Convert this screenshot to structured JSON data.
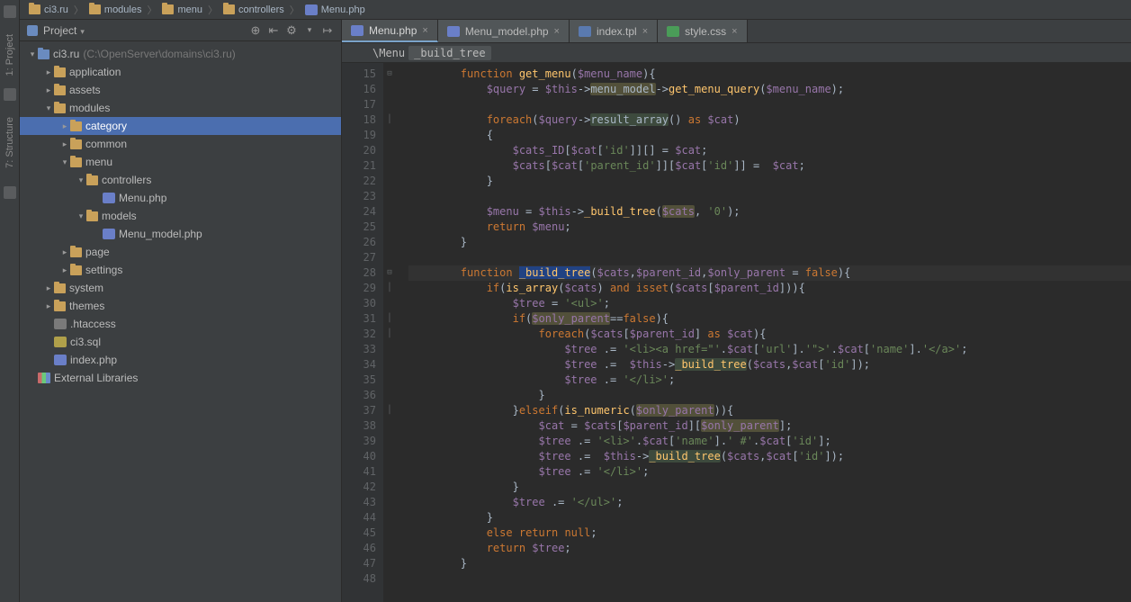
{
  "breadcrumb": [
    {
      "icon": "folder",
      "label": "ci3.ru"
    },
    {
      "icon": "folder",
      "label": "modules"
    },
    {
      "icon": "folder",
      "label": "menu"
    },
    {
      "icon": "folder",
      "label": "controllers"
    },
    {
      "icon": "php",
      "label": "Menu.php"
    }
  ],
  "sidebar_tools": {
    "project": "1: Project",
    "structure": "7: Structure"
  },
  "project_panel": {
    "title": "Project",
    "root_label": "ci3.ru",
    "root_hint": "(C:\\OpenServer\\domains\\ci3.ru)"
  },
  "tree": [
    {
      "depth": 0,
      "arrow": "▾",
      "icon": "folder-blue",
      "label": "ci3.ru",
      "hint": "(C:\\OpenServer\\domains\\ci3.ru)"
    },
    {
      "depth": 1,
      "arrow": "▸",
      "icon": "folder",
      "label": "application"
    },
    {
      "depth": 1,
      "arrow": "▸",
      "icon": "folder",
      "label": "assets"
    },
    {
      "depth": 1,
      "arrow": "▾",
      "icon": "folder",
      "label": "modules"
    },
    {
      "depth": 2,
      "arrow": "▸",
      "icon": "folder",
      "label": "category",
      "selected": true
    },
    {
      "depth": 2,
      "arrow": "▸",
      "icon": "folder",
      "label": "common"
    },
    {
      "depth": 2,
      "arrow": "▾",
      "icon": "folder",
      "label": "menu"
    },
    {
      "depth": 3,
      "arrow": "▾",
      "icon": "folder",
      "label": "controllers"
    },
    {
      "depth": 4,
      "arrow": " ",
      "icon": "php",
      "label": "Menu.php"
    },
    {
      "depth": 3,
      "arrow": "▾",
      "icon": "folder",
      "label": "models"
    },
    {
      "depth": 4,
      "arrow": " ",
      "icon": "php",
      "label": "Menu_model.php"
    },
    {
      "depth": 2,
      "arrow": "▸",
      "icon": "folder",
      "label": "page"
    },
    {
      "depth": 2,
      "arrow": "▸",
      "icon": "folder",
      "label": "settings"
    },
    {
      "depth": 1,
      "arrow": "▸",
      "icon": "folder",
      "label": "system"
    },
    {
      "depth": 1,
      "arrow": "▸",
      "icon": "folder",
      "label": "themes"
    },
    {
      "depth": 1,
      "arrow": " ",
      "icon": "txt",
      "label": ".htaccess"
    },
    {
      "depth": 1,
      "arrow": " ",
      "icon": "sql",
      "label": "ci3.sql"
    },
    {
      "depth": 1,
      "arrow": " ",
      "icon": "php",
      "label": "index.php"
    },
    {
      "depth": 0,
      "arrow": " ",
      "icon": "lib",
      "label": "External Libraries"
    }
  ],
  "tabs": [
    {
      "icon": "php",
      "label": "Menu.php",
      "active": true
    },
    {
      "icon": "php",
      "label": "Menu_model.php"
    },
    {
      "icon": "tpl",
      "label": "index.tpl"
    },
    {
      "icon": "css",
      "label": "style.css"
    }
  ],
  "subnav": {
    "seg1": "\\Menu",
    "seg2": "_build_tree"
  },
  "first_line_no": 15,
  "code_lines": [
    {
      "t": "        <span class='kw'>function</span> <span class='fn'>get_menu</span>(<span class='var'>$menu_name</span>){"
    },
    {
      "t": "            <span class='var'>$query</span> = <span class='var'>$this</span>-><span class='warn'>menu_model</span>-><span class='fn'>get_menu_query</span>(<span class='var'>$menu_name</span>);"
    },
    {
      "t": " "
    },
    {
      "t": "            <span class='kw'>foreach</span>(<span class='var'>$query</span>-><span class='hly'>result_array</span>() <span class='kw'>as</span> <span class='var'>$cat</span>)"
    },
    {
      "t": "            {"
    },
    {
      "t": "                <span class='var'>$cats_ID</span>[<span class='var'>$cat</span>[<span class='str'>'id'</span>]][] = <span class='var'>$cat</span>;"
    },
    {
      "t": "                <span class='var'>$cats</span>[<span class='var'>$cat</span>[<span class='str'>'parent_id'</span>]][<span class='var'>$cat</span>[<span class='str'>'id'</span>]] =  <span class='var'>$cat</span>;"
    },
    {
      "t": "            }"
    },
    {
      "t": " "
    },
    {
      "t": "            <span class='var'>$menu</span> = <span class='var'>$this</span>-><span class='fn'>_build_tree</span>(<span class='var warn'>$cats</span>, <span class='str'>'0'</span>);"
    },
    {
      "t": "            <span class='kw'>return</span> <span class='var'>$menu</span>;"
    },
    {
      "t": "        }"
    },
    {
      "t": " "
    },
    {
      "t": "        <span class='kw'>function</span> <span class='fn hlactive'>_build_tree</span>(<span class='var'>$cats</span>,<span class='var'>$parent_id</span>,<span class='var'>$only_parent</span> = <span class='const'>false</span>){",
      "bg": true
    },
    {
      "t": "            <span class='kw'>if</span>(<span class='fn'>is_array</span>(<span class='var'>$cats</span>) <span class='kw'>and</span> <span class='kw'>isset</span>(<span class='var'>$cats</span>[<span class='var'>$parent_id</span>])){"
    },
    {
      "t": "                <span class='var'>$tree</span> = <span class='str'>'&lt;ul&gt;'</span>;"
    },
    {
      "t": "                <span class='kw'>if</span>(<span class='var warn'>$only_parent</span>==<span class='const'>false</span>){"
    },
    {
      "t": "                    <span class='kw'>foreach</span>(<span class='var'>$cats</span>[<span class='var'>$parent_id</span>] <span class='kw'>as</span> <span class='var'>$cat</span>){"
    },
    {
      "t": "                        <span class='var'>$tree</span> .= <span class='str'>'&lt;li&gt;&lt;a href=\"'</span>.<span class='var'>$cat</span>[<span class='str'>'url'</span>].<span class='str'>'\"&gt;'</span>.<span class='var'>$cat</span>[<span class='str'>'name'</span>].<span class='str'>'&lt;/a&gt;'</span>;"
    },
    {
      "t": "                        <span class='var'>$tree</span> .=  <span class='var'>$this</span>-><span class='fn hly'>_build_tree</span>(<span class='var'>$cats</span>,<span class='var'>$cat</span>[<span class='str'>'id'</span>]);"
    },
    {
      "t": "                        <span class='var'>$tree</span> .= <span class='str'>'&lt;/li&gt;'</span>;"
    },
    {
      "t": "                    }"
    },
    {
      "t": "                }<span class='kw'>elseif</span>(<span class='fn'>is_numeric</span>(<span class='var warn'>$only_parent</span>)){"
    },
    {
      "t": "                    <span class='var'>$cat</span> = <span class='var'>$cats</span>[<span class='var'>$parent_id</span>][<span class='var warn'>$only_parent</span>];"
    },
    {
      "t": "                    <span class='var'>$tree</span> .= <span class='str'>'&lt;li&gt;'</span>.<span class='var'>$cat</span>[<span class='str'>'name'</span>].<span class='str'>' #'</span>.<span class='var'>$cat</span>[<span class='str'>'id'</span>];"
    },
    {
      "t": "                    <span class='var'>$tree</span> .=  <span class='var'>$this</span>-><span class='fn hly'>_build_tree</span>(<span class='var'>$cats</span>,<span class='var'>$cat</span>[<span class='str'>'id'</span>]);"
    },
    {
      "t": "                    <span class='var'>$tree</span> .= <span class='str'>'&lt;/li&gt;'</span>;"
    },
    {
      "t": "                }"
    },
    {
      "t": "                <span class='var'>$tree</span> .= <span class='str'>'&lt;/ul&gt;'</span>;"
    },
    {
      "t": "            }"
    },
    {
      "t": "            <span class='kw'>else</span> <span class='kw'>return</span> <span class='const'>null</span>;"
    },
    {
      "t": "            <span class='kw'>return</span> <span class='var'>$tree</span>;"
    },
    {
      "t": "        }"
    },
    {
      "t": " "
    }
  ]
}
